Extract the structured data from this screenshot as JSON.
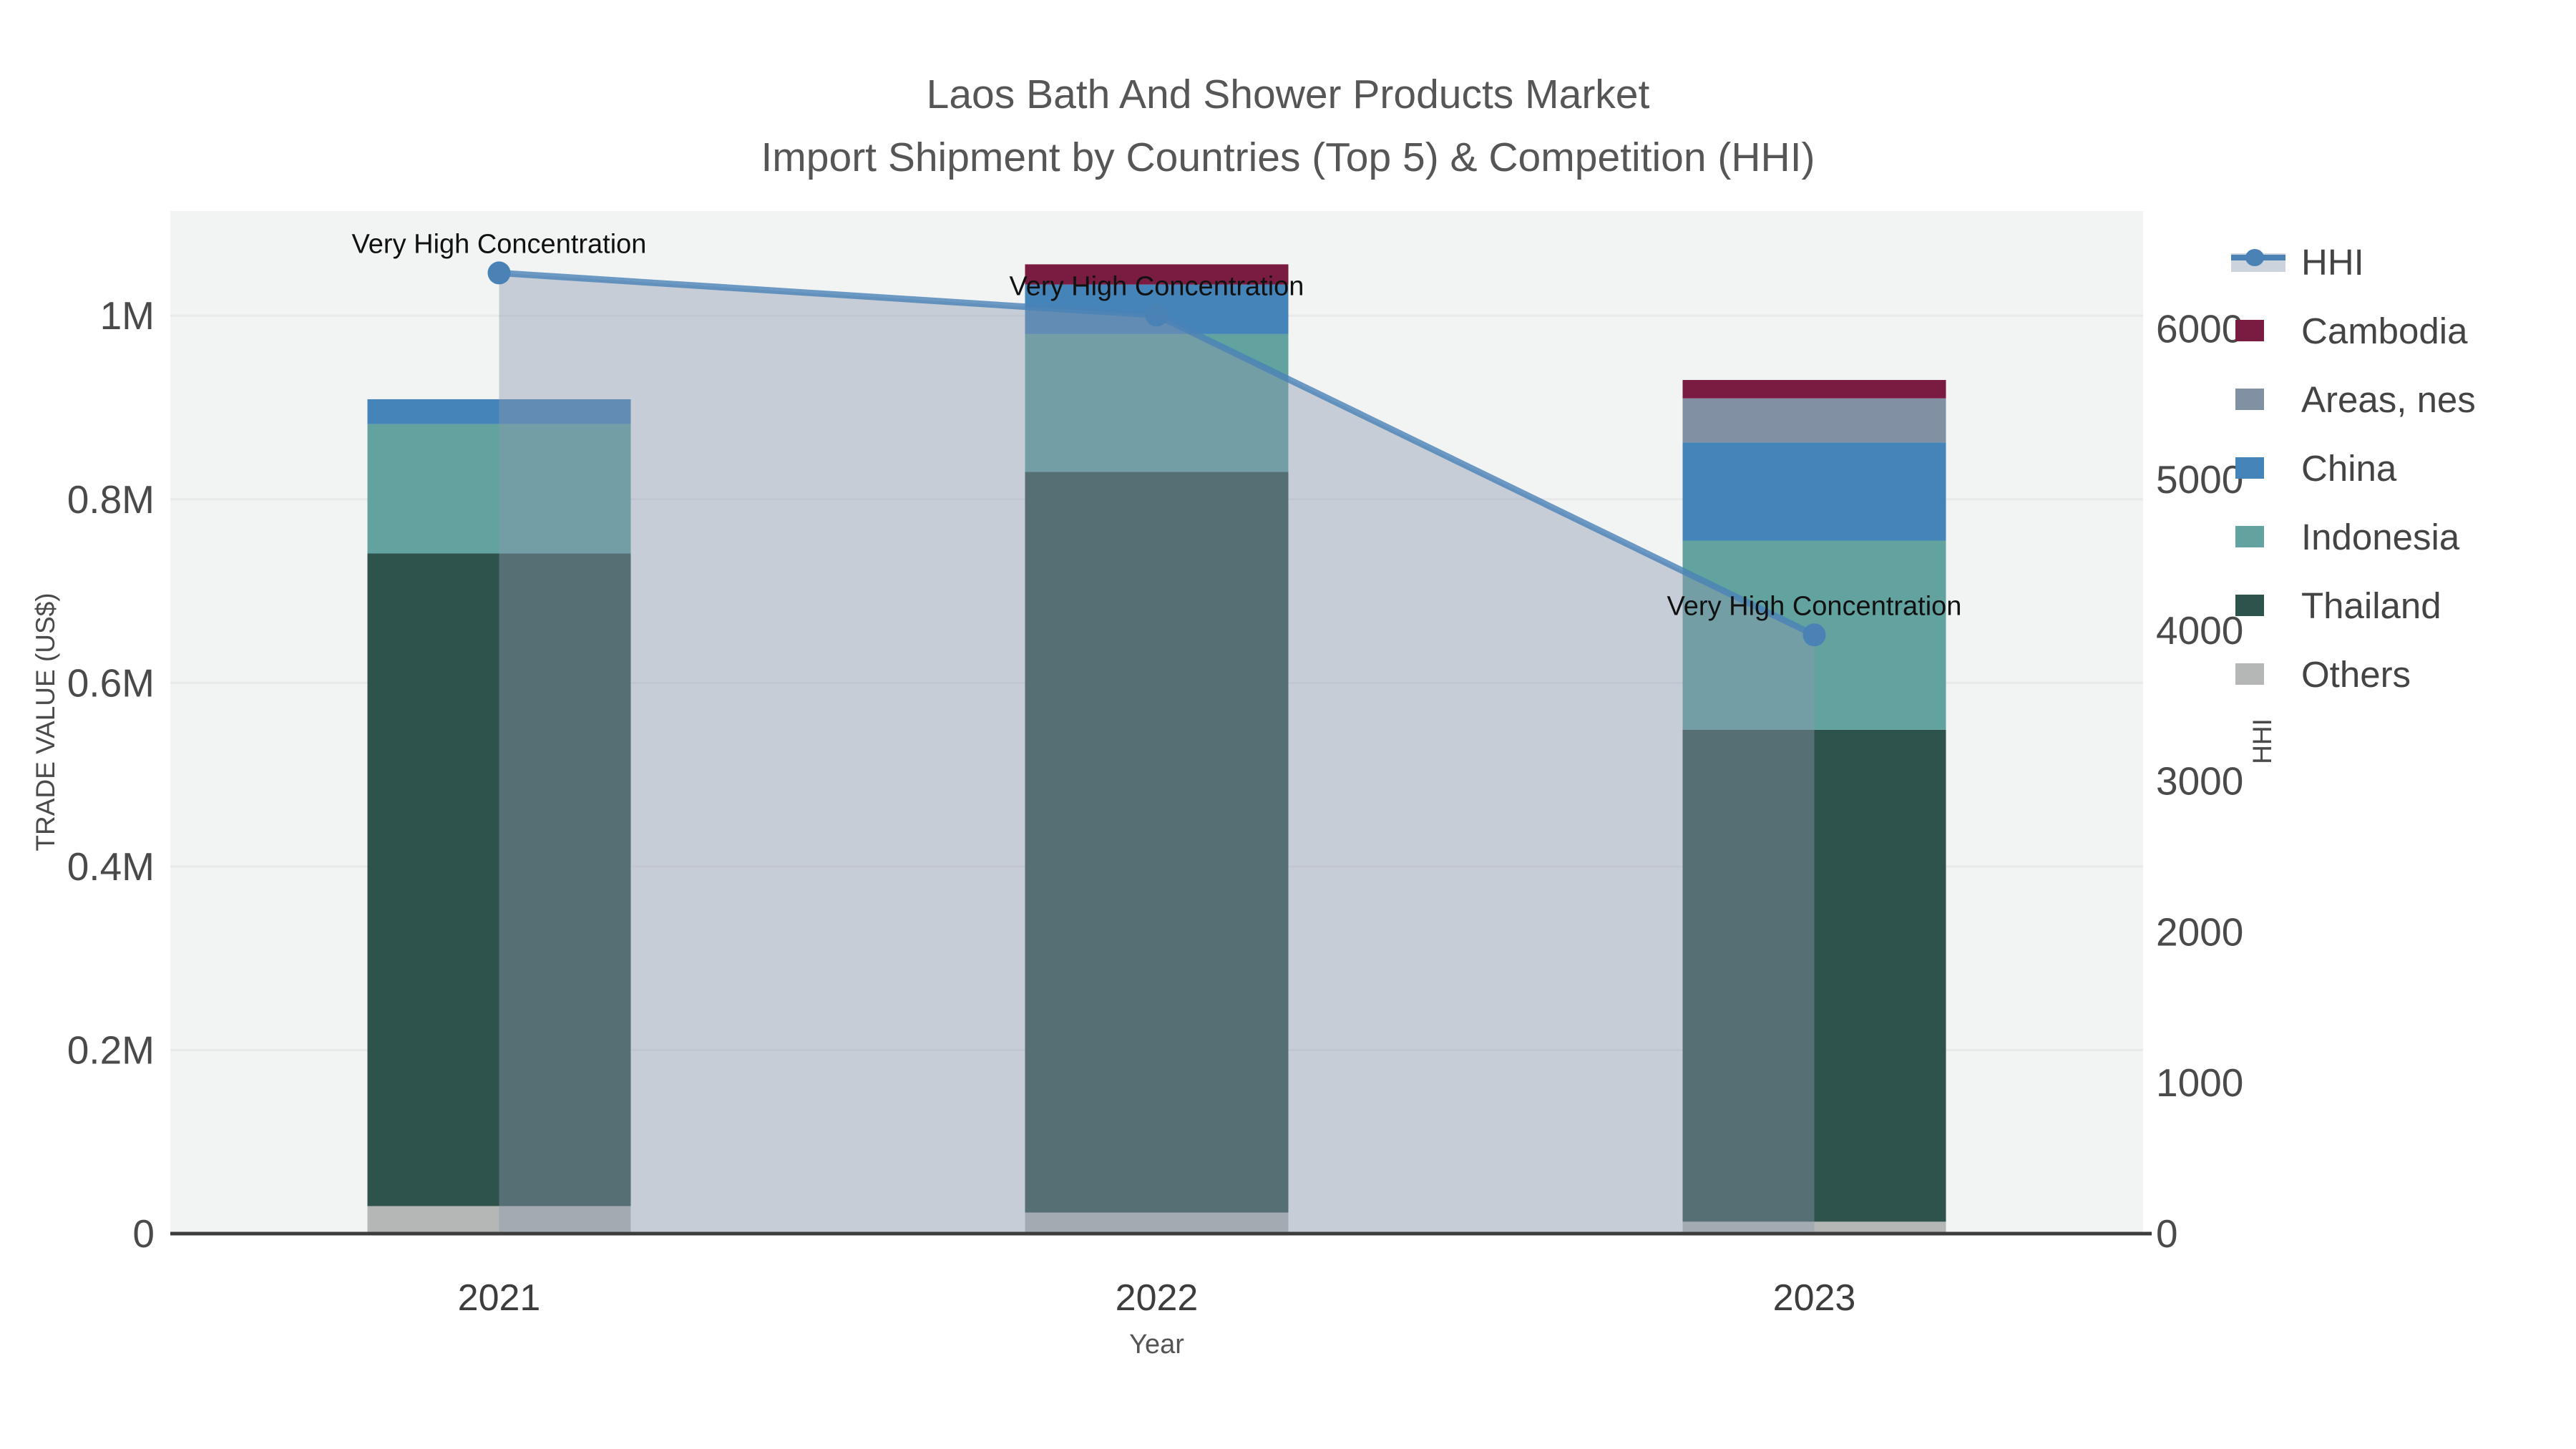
{
  "title": {
    "line1": "Laos Bath And Shower Products Market",
    "line2": "Import Shipment by Countries (Top 5) & Competition (HHI)"
  },
  "axes": {
    "x": {
      "label": "Year",
      "categories": [
        "2021",
        "2022",
        "2023"
      ]
    },
    "y_left": {
      "label": "TRADE VALUE (US$)",
      "tick_labels": [
        "0",
        "0.2M",
        "0.4M",
        "0.6M",
        "0.8M",
        "1M"
      ],
      "tick_values": [
        0,
        200000,
        400000,
        600000,
        800000,
        1000000
      ]
    },
    "y_right": {
      "label": "HHI",
      "tick_labels": [
        "0",
        "1000",
        "2000",
        "3000",
        "4000",
        "5000",
        "6000"
      ],
      "tick_values": [
        0,
        1000,
        2000,
        3000,
        4000,
        5000,
        6000
      ]
    }
  },
  "legend": {
    "items": [
      {
        "label": "HHI",
        "type": "line",
        "color": "#4a82b6"
      },
      {
        "label": "Cambodia",
        "type": "square",
        "color": "#7a1b41"
      },
      {
        "label": "Areas, nes",
        "type": "square",
        "color": "#8191a3"
      },
      {
        "label": "China",
        "type": "square",
        "color": "#4484b8"
      },
      {
        "label": "Indonesia",
        "type": "square",
        "color": "#62a3a0"
      },
      {
        "label": "Thailand",
        "type": "square",
        "color": "#2e524c"
      },
      {
        "label": "Others",
        "type": "square",
        "color": "#b5b7b6"
      }
    ]
  },
  "chart_data": {
    "type": "bar",
    "subtype": "stacked bars (left axis) + line with area fill (right axis)",
    "title": "Laos Bath And Shower Products Market — Import Shipment by Countries (Top 5) & Competition (HHI)",
    "xlabel": "Year",
    "ylabel_left": "TRADE VALUE (US$)",
    "ylabel_right": "HHI",
    "categories": [
      "2021",
      "2022",
      "2023"
    ],
    "series": [
      {
        "name": "Cambodia",
        "axis": "left",
        "color": "#7a1b41",
        "values": [
          0,
          22000,
          20000
        ]
      },
      {
        "name": "Areas, nes",
        "axis": "left",
        "color": "#8191a3",
        "values": [
          0,
          0,
          48000
        ]
      },
      {
        "name": "China",
        "axis": "left",
        "color": "#4484b8",
        "values": [
          27000,
          54000,
          107000
        ]
      },
      {
        "name": "Indonesia",
        "axis": "left",
        "color": "#62a3a0",
        "values": [
          141000,
          150000,
          206000
        ]
      },
      {
        "name": "Thailand",
        "axis": "left",
        "color": "#2e524c",
        "values": [
          711000,
          807000,
          536000
        ]
      },
      {
        "name": "Others",
        "axis": "left",
        "color": "#b5b7b6",
        "values": [
          30000,
          23000,
          13000
        ]
      }
    ],
    "line_series": {
      "name": "HHI",
      "axis": "right",
      "color": "#4a82b6",
      "area_fill": "rgba(141,153,173,0.42)",
      "values": [
        6370,
        6090,
        3970
      ]
    },
    "annotations": [
      "Very High Concentration",
      "Very High Concentration",
      "Very High Concentration"
    ],
    "ylim_left": [
      0,
      1114000
    ],
    "ylim_right": [
      0,
      6780
    ],
    "grid": true,
    "legend_position": "right",
    "colors": {
      "panel_background": "#f2f3f3",
      "gridline": "#e7e9ea",
      "axis_line": "#3c3c3c",
      "tick_text": "#4a4a4a",
      "title_text": "#565656",
      "annotation_text": "#111111"
    }
  }
}
